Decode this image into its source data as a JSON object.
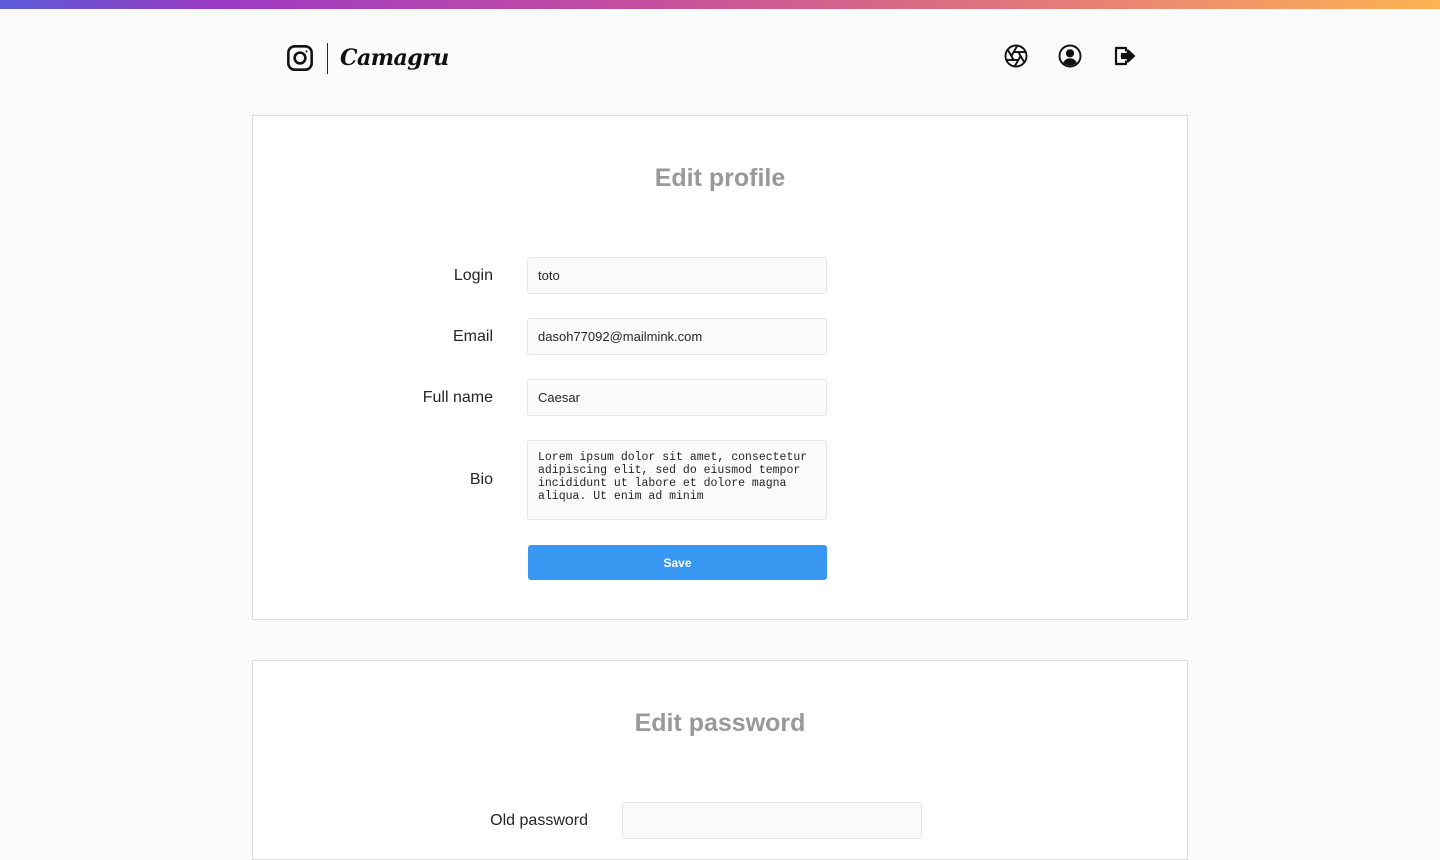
{
  "header": {
    "brand": "Camagru",
    "icons": [
      "instagram-icon",
      "aperture-icon",
      "user-circle-icon",
      "logout-icon"
    ]
  },
  "profile_form": {
    "title": "Edit profile",
    "login_label": "Login",
    "login_value": "toto",
    "email_label": "Email",
    "email_value": "dasoh77092@mailmink.com",
    "fullname_label": "Full name",
    "fullname_value": "Caesar",
    "bio_label": "Bio",
    "bio_value": "Lorem ipsum dolor sit amet, consectetur adipiscing elit, sed do eiusmod tempor incididunt ut labore et dolore magna aliqua. Ut enim ad minim",
    "save_label": "Save"
  },
  "password_form": {
    "title": "Edit password",
    "old_password_label": "Old password",
    "old_password_value": ""
  },
  "colors": {
    "accent": "#3897f0",
    "title_gray": "#999999",
    "border": "#dbdbdb"
  }
}
